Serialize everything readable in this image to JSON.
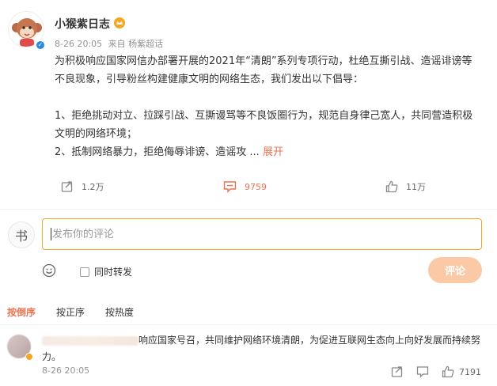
{
  "post": {
    "author": "小猴紫日志",
    "time": "8-26 20:05",
    "source": "来自 杨紫超话",
    "paragraphs": [
      "为积极响应国家网信办部署开展的2021年“清朗”系列专项行动，杜绝互撕引战、造谣诽谤等不良现象，引导粉丝构建健康文明的网络生态，我们发出以下倡导：",
      "",
      "1、拒绝挑动对立、拉踩引战、互撕谩骂等不良饭圈行为，规范自身律己宽人，共同营造积极文明的网络环境；",
      "2、抵制网络暴力，拒绝侮辱诽谤、造谣攻 ... "
    ],
    "expand_label": "展开",
    "actions": {
      "repost": "1.2万",
      "comment": "9759",
      "like": "11万"
    }
  },
  "composer": {
    "avatar_char": "书",
    "placeholder": "发布你的评论",
    "repost_label": "同时转发",
    "submit_label": "评论"
  },
  "sort_tabs": [
    "按倒序",
    "按正序",
    "按热度"
  ],
  "comment": {
    "text": "响应国家号召，共同维护网络环境清朗，为促进互联网生态向上向好发展而持续努力。",
    "time": "8-26 20:05",
    "likes": "7191"
  },
  "colors": {
    "accent": "#eb7350",
    "focus_border": "#f5a623",
    "submit_bg": "#fcc9a6",
    "verified_blue": "#2b88e0"
  }
}
